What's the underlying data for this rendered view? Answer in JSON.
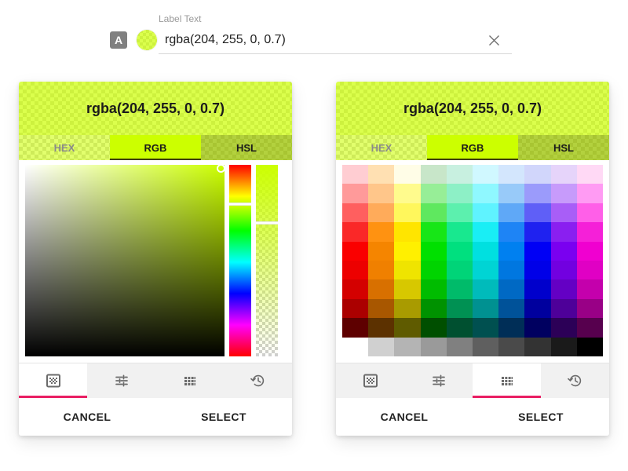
{
  "field": {
    "label": "Label Text",
    "value": "rgba(204, 255, 0, 0.7)",
    "type_badge": "A",
    "clear_icon": "close-icon",
    "swatch_color": "rgba(204, 255, 0, 0.7)"
  },
  "color": {
    "css": "rgba(204, 255, 0, 0.7)",
    "hex": "#CCFF00",
    "rgb": [
      204,
      255,
      0
    ],
    "alpha": 0.7,
    "hue_deg": 72
  },
  "panels": [
    {
      "id": "gradient-panel",
      "title": "rgba(204, 255, 0, 0.7)",
      "tabs": [
        {
          "label": "HEX",
          "state": "inactive"
        },
        {
          "label": "RGB",
          "state": "active"
        },
        {
          "label": "HSL",
          "state": "hover"
        }
      ],
      "mode": "gradient",
      "icon_tabs": [
        {
          "name": "spectrum-icon",
          "selected": true
        },
        {
          "name": "tune-icon",
          "selected": false
        },
        {
          "name": "palette-grid-icon",
          "selected": false
        },
        {
          "name": "history-icon",
          "selected": false
        }
      ],
      "actions": [
        {
          "label": "CANCEL",
          "name": "cancel-button"
        },
        {
          "label": "SELECT",
          "name": "select-button"
        }
      ]
    },
    {
      "id": "palette-panel",
      "title": "rgba(204, 255, 0, 0.7)",
      "tabs": [
        {
          "label": "HEX",
          "state": "inactive"
        },
        {
          "label": "RGB",
          "state": "active"
        },
        {
          "label": "HSL",
          "state": "hover"
        }
      ],
      "mode": "palette",
      "icon_tabs": [
        {
          "name": "spectrum-icon",
          "selected": false
        },
        {
          "name": "tune-icon",
          "selected": false
        },
        {
          "name": "palette-grid-icon",
          "selected": true
        },
        {
          "name": "history-icon",
          "selected": false
        }
      ],
      "actions": [
        {
          "label": "CANCEL",
          "name": "cancel-button"
        },
        {
          "label": "SELECT",
          "name": "select-button"
        }
      ]
    }
  ],
  "accent": "#e91e63",
  "palette_rows": [
    [
      "#ffcdd2",
      "#ffe0b2",
      "#fffde7",
      "#c8e6c9",
      "#c8f0e0",
      "#d0f8ff",
      "#d3e6fd",
      "#d1d6fb",
      "#e6d4fa",
      "#ffd9f5"
    ],
    [
      "#ff9a9a",
      "#ffc68a",
      "#fffb8d",
      "#97ee97",
      "#8df0c6",
      "#8ff8ff",
      "#98caf9",
      "#9b9bfb",
      "#c79bfb",
      "#ff9bf3"
    ],
    [
      "#ff5f5f",
      "#ffab5a",
      "#fff75c",
      "#5fe85f",
      "#5cf0ae",
      "#5ff3ff",
      "#5fa8f7",
      "#5f5ff7",
      "#a85ef7",
      "#ff5fe8"
    ],
    [
      "#fa2828",
      "#ff9211",
      "#ffe500",
      "#17e617",
      "#18e88f",
      "#19eef5",
      "#1e84f5",
      "#1f22f0",
      "#8a1ff0",
      "#f520d8"
    ],
    [
      "#fa0000",
      "#f58500",
      "#fff000",
      "#00e000",
      "#00e07f",
      "#00e0e0",
      "#0080f0",
      "#0000f5",
      "#7a00f0",
      "#f000d0"
    ],
    [
      "#ed0000",
      "#f08000",
      "#efe400",
      "#00d400",
      "#00d478",
      "#00d4d4",
      "#0077e0",
      "#0000e8",
      "#7200e0",
      "#e000c4"
    ],
    [
      "#d40000",
      "#d87000",
      "#d7c800",
      "#00bc00",
      "#00bb6a",
      "#00bbbb",
      "#0069c4",
      "#0000cc",
      "#6400c4",
      "#c400ac"
    ],
    [
      "#ab0000",
      "#a85700",
      "#a99b00",
      "#009200",
      "#009153",
      "#009191",
      "#005299",
      "#00009e",
      "#4e0099",
      "#990086"
    ],
    [
      "#5e0000",
      "#5c3100",
      "#5f5b00",
      "#004f00",
      "#005030",
      "#005050",
      "#002e57",
      "#000060",
      "#2c0057",
      "#57004e"
    ]
  ],
  "palette_gray_row": [
    "#ffffff",
    "#d0d0d0",
    "#b4b4b4",
    "#9a9a9a",
    "#808080",
    "#5f5f5f",
    "#4a4a4a",
    "#333333",
    "#1a1a1a",
    "#000000"
  ]
}
